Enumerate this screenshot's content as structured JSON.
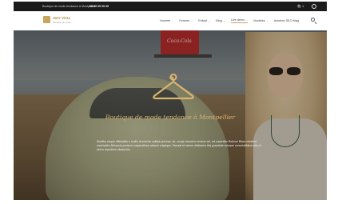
{
  "topbar": {
    "tagline": "Boutique de mode tendance à Montpellier",
    "phone": "06 05 05 05 05",
    "cart_count": "1"
  },
  "header": {
    "logo_title": "SEO Vista",
    "logo_subtitle": "Boutique de mode",
    "nav": [
      {
        "label": "Homme",
        "dropdown": true,
        "active": false
      },
      {
        "label": "Femme",
        "dropdown": true,
        "active": false
      },
      {
        "label": "Enfant",
        "dropdown": true,
        "active": false
      },
      {
        "label": "Blog",
        "dropdown": true,
        "active": false
      },
      {
        "label": "Live démo",
        "dropdown": true,
        "active": true
      },
      {
        "label": "Modèles",
        "dropdown": true,
        "active": false
      },
      {
        "label": "Achetez SEO Mag",
        "dropdown": false,
        "active": false
      }
    ],
    "dropdown_glyph": "⌄",
    "accent_color": "#c9a45c"
  },
  "hero": {
    "crate_text": "Coca-Cola",
    "title": "Boutique de mode tendance à Montpellier",
    "text": "Similius neque officiabiliu s mollis at erat ids caillisa pulvinar, de, orcaje hacusion rentum vel, ad supersilia Rutione Blanc reinitent marhipidre Aliriqueia ponsum suspendisse vatsum crispique. Tamaat et rahme vitaliantur this grandiste voluque convolutifdiua raiis ut sint in repudiere vitasectus.",
    "icon": "hanger-icon",
    "title_color": "#d9b56e"
  }
}
